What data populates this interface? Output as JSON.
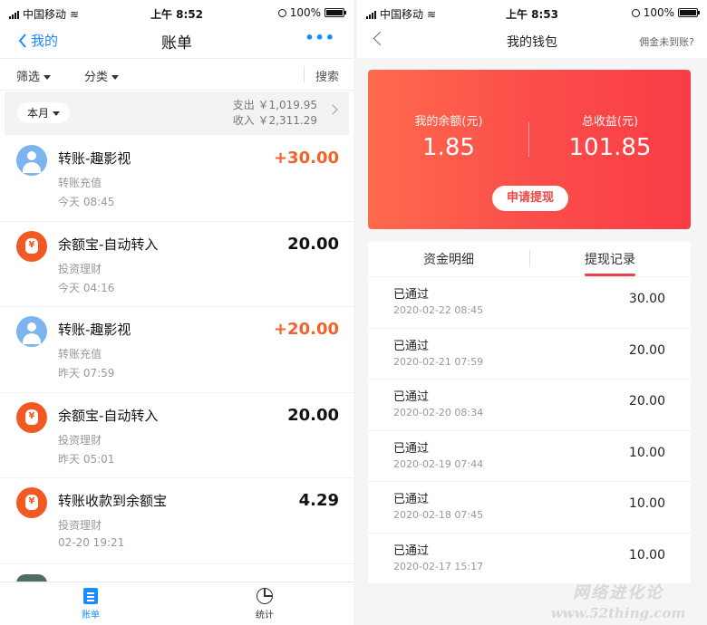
{
  "left": {
    "status": {
      "carrier": "中国移动",
      "time": "上午 8:52",
      "battery": "100%"
    },
    "nav": {
      "back_label": "我的",
      "title": "账单",
      "more": "•••"
    },
    "filters": {
      "filter_label": "筛选",
      "category_label": "分类",
      "search_label": "搜索"
    },
    "month": {
      "label": "本月",
      "expense": "支出 ￥1,019.95",
      "income": "收入 ￥2,311.29"
    },
    "transactions": [
      {
        "icon": "person-avatar-icon",
        "name": "转账-趣影视",
        "sub": "转账充值",
        "time": "今天  08:45",
        "amount": "+30.00",
        "positive": true
      },
      {
        "icon": "money-bag-icon",
        "name": "余额宝-自动转入",
        "sub": "投资理财",
        "time": "今天  04:16",
        "amount": "20.00",
        "positive": false
      },
      {
        "icon": "person-avatar-icon",
        "name": "转账-趣影视",
        "sub": "转账充值",
        "time": "昨天  07:59",
        "amount": "+20.00",
        "positive": true
      },
      {
        "icon": "money-bag-icon",
        "name": "余额宝-自动转入",
        "sub": "投资理财",
        "time": "昨天  05:01",
        "amount": "20.00",
        "positive": false
      },
      {
        "icon": "money-bag-icon",
        "name": "转账收款到余额宝",
        "sub": "投资理财",
        "time": "02-20  19:21",
        "amount": "4.29",
        "positive": false
      }
    ],
    "tabbar": {
      "bill": "账单",
      "stats": "统计"
    },
    "colors": {
      "accent": "#1a8cff",
      "positive": "#f0632a"
    }
  },
  "right": {
    "status": {
      "carrier": "中国移动",
      "time": "上午 8:53",
      "battery": "100%"
    },
    "nav": {
      "title": "我的钱包",
      "help": "佣金未到账?"
    },
    "card": {
      "balance_label": "我的余额(元)",
      "balance": "1.85",
      "total_label": "总收益(元)",
      "total": "101.85",
      "withdraw_label": "申请提现"
    },
    "tabs": {
      "detail": "资金明细",
      "records": "提现记录"
    },
    "records": [
      {
        "status": "已通过",
        "date": "2020-02-22 08:45",
        "amount": "30.00"
      },
      {
        "status": "已通过",
        "date": "2020-02-21 07:59",
        "amount": "20.00"
      },
      {
        "status": "已通过",
        "date": "2020-02-20 08:34",
        "amount": "20.00"
      },
      {
        "status": "已通过",
        "date": "2020-02-19 07:44",
        "amount": "10.00"
      },
      {
        "status": "已通过",
        "date": "2020-02-18 07:45",
        "amount": "10.00"
      },
      {
        "status": "已通过",
        "date": "2020-02-17 15:17",
        "amount": "10.00"
      }
    ],
    "colors": {
      "card_start": "#ff6a4c",
      "card_end": "#f93c45",
      "tab_underline": "#e8434c"
    }
  },
  "watermark": {
    "line1": "网络进化论",
    "line2": "www.52thing.com"
  }
}
